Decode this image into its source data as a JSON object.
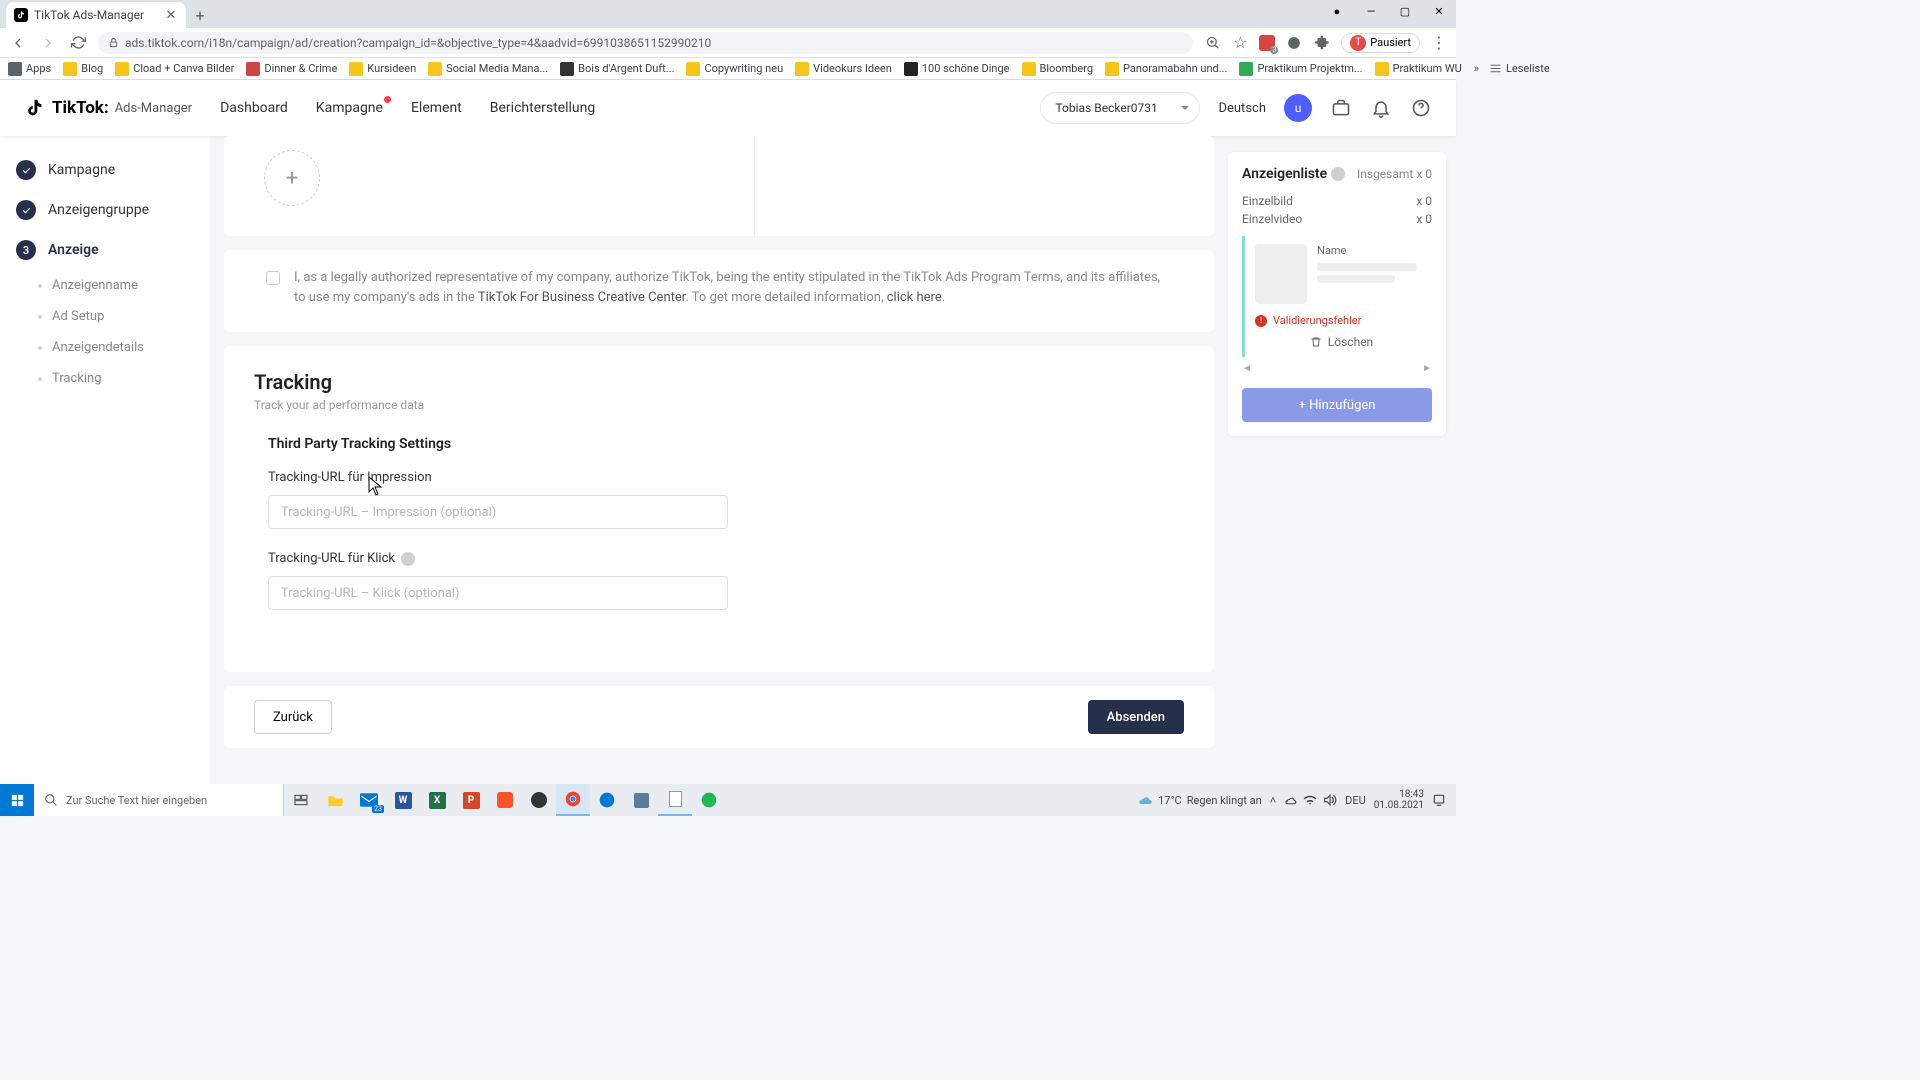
{
  "browser": {
    "tab_title": "TikTok Ads-Manager",
    "url": "ads.tiktok.com/i18n/campaign/ad/creation?campaign_id=&objective_type=4&aadvid=6991038651152990210",
    "ext_label": "Pausiert",
    "bookmarks": [
      "Apps",
      "Blog",
      "Cload + Canva Bilder",
      "Dinner & Crime",
      "Kursideen",
      "Social Media Mana...",
      "Bois d'Argent Duft...",
      "Copywriting neu",
      "Videokurs Ideen",
      "100 schöne Dinge",
      "Bloomberg",
      "Panoramabahn und...",
      "Praktikum Projektm...",
      "Praktikum WU"
    ],
    "reading_list": "Leseliste"
  },
  "header": {
    "logo_main": "TikTok:",
    "logo_sub": "Ads-Manager",
    "nav": [
      "Dashboard",
      "Kampagne",
      "Element",
      "Berichterstellung"
    ],
    "account": "Tobias Becker0731",
    "lang": "Deutsch",
    "avatar": "u"
  },
  "sidebar": {
    "steps": [
      {
        "label": "Kampagne",
        "done": true
      },
      {
        "label": "Anzeigengruppe",
        "done": true
      },
      {
        "label": "Anzeige",
        "num": "3",
        "active": true
      }
    ],
    "subs": [
      "Anzeigenname",
      "Ad Setup",
      "Anzeigendetails",
      "Tracking"
    ]
  },
  "consent": {
    "pre": "I, as a legally authorized representative of my company, authorize TikTok, being the entity stipulated in the TikTok Ads Program Terms, and its affiliates, to use my company's ads in the ",
    "link1": "TikTok For Business Creative Center",
    "mid": ". To get more detailed information, ",
    "link2": "click here",
    "post": "."
  },
  "tracking": {
    "title": "Tracking",
    "subtitle": "Track your ad performance data",
    "section": "Third Party Tracking Settings",
    "impression_label": "Tracking-URL für Impression",
    "impression_ph": "Tracking-URL – Impression (optional)",
    "click_label": "Tracking-URL für Klick",
    "click_ph": "Tracking-URL – Klick (optional)"
  },
  "footer": {
    "back": "Zurück",
    "submit": "Absenden"
  },
  "panel": {
    "title": "Anzeigenliste",
    "total": "Insgesamt x 0",
    "stats": [
      {
        "label": "Einzelbild",
        "count": "x 0"
      },
      {
        "label": "Einzelvideo",
        "count": "x 0"
      }
    ],
    "name": "Name",
    "error": "Validierungsfehler",
    "delete": "Löschen",
    "add": "+ Hinzufügen"
  },
  "taskbar": {
    "search_ph": "Zur Suche Text hier eingeben",
    "weather_temp": "17°C",
    "weather_text": "Regen klingt an",
    "time": "18:43",
    "date": "01.08.2021",
    "lang": "DEU"
  }
}
